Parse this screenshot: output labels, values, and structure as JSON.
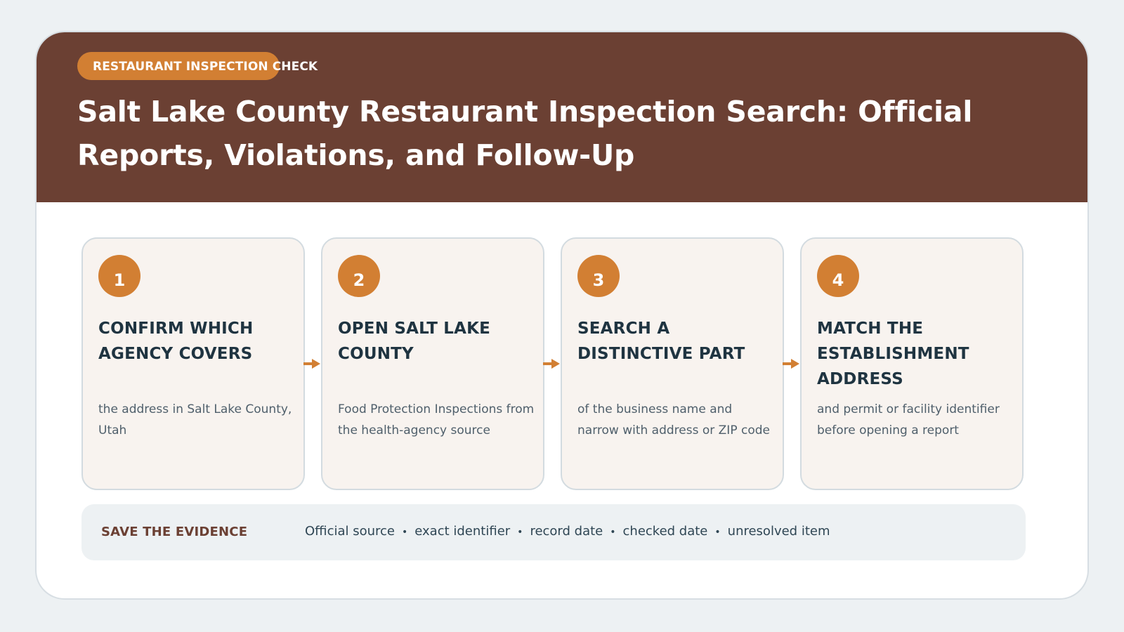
{
  "header": {
    "badge": "RESTAURANT INSPECTION CHECK",
    "title": "Salt Lake County Restaurant Inspection Search: Official Reports, Violations, and Follow-Up"
  },
  "steps": [
    {
      "number": "1",
      "heading": "CONFIRM WHICH AGENCY COVERS",
      "detail": "the address in Salt Lake County, Utah"
    },
    {
      "number": "2",
      "heading": "OPEN SALT LAKE COUNTY",
      "detail": "Food Protection Inspections from the health-agency source"
    },
    {
      "number": "3",
      "heading": "SEARCH A DISTINCTIVE PART",
      "detail": "of the business name and narrow with address or ZIP code"
    },
    {
      "number": "4",
      "heading": "MATCH THE ESTABLISHMENT ADDRESS",
      "detail": "and permit or facility identifier before opening a report"
    }
  ],
  "evidence": {
    "label": "SAVE THE EVIDENCE",
    "items": [
      "Official source",
      "exact identifier",
      "record date",
      "checked date",
      "unresolved item"
    ],
    "separator": "•"
  },
  "colors": {
    "header_bg": "#6b4033",
    "accent": "#d27f33",
    "step_bg": "#f8f3ef",
    "heading_text": "#1f3441"
  },
  "icons": {
    "connector": "arrow-right-icon"
  }
}
